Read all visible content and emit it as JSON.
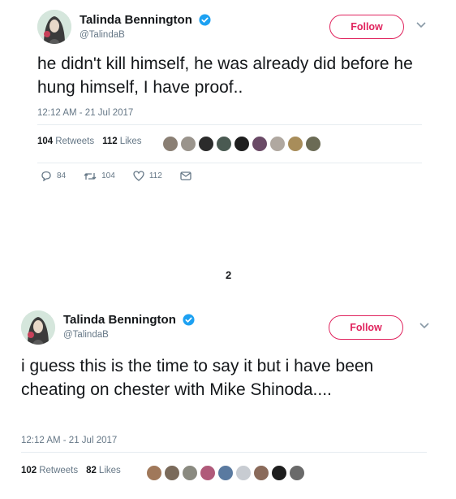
{
  "tweets": [
    {
      "name": "Talinda Bennington",
      "handle": "@TalindaB",
      "follow_label": "Follow",
      "text": "he didn't kill himself, he was already did before he hung himself, I have proof..",
      "timestamp": "12:12 AM - 21 Jul 2017",
      "retweets_count": "104",
      "retweets_label": "Retweets",
      "likes_count": "112",
      "likes_label": "Likes",
      "replies": "84",
      "retweet_action": "104",
      "like_action": "112",
      "liker_avatar_colors": [
        "#8a7f74",
        "#9a948c",
        "#2b2b2b",
        "#4a5a52",
        "#1e1e1e",
        "#6a4a66",
        "#b0a8a0",
        "#a88d5a",
        "#6b6b55"
      ]
    },
    {
      "name": "Talinda Bennington",
      "handle": "@TalindaB",
      "follow_label": "Follow",
      "text": "i guess this is the time to say it but i have been cheating on chester with Mike Shinoda....",
      "timestamp": "12:12 AM - 21 Jul 2017",
      "retweets_count": "102",
      "retweets_label": "Retweets",
      "likes_count": "82",
      "likes_label": "Likes",
      "liker_avatar_colors": [
        "#a0785a",
        "#7a6a5a",
        "#8a8a80",
        "#b05a7a",
        "#5a7aa0",
        "#c8ccd2",
        "#8a6a5a",
        "#1e1e1e",
        "#6a6a6a"
      ]
    }
  ],
  "separator_label": "2",
  "colors": {
    "follow_accent": "#e0245e",
    "verified_blue": "#1da1f2",
    "secondary_text": "#657786"
  },
  "icons": [
    "verified-badge-icon",
    "chevron-down-icon",
    "reply-icon",
    "retweet-icon",
    "like-icon",
    "message-icon"
  ]
}
